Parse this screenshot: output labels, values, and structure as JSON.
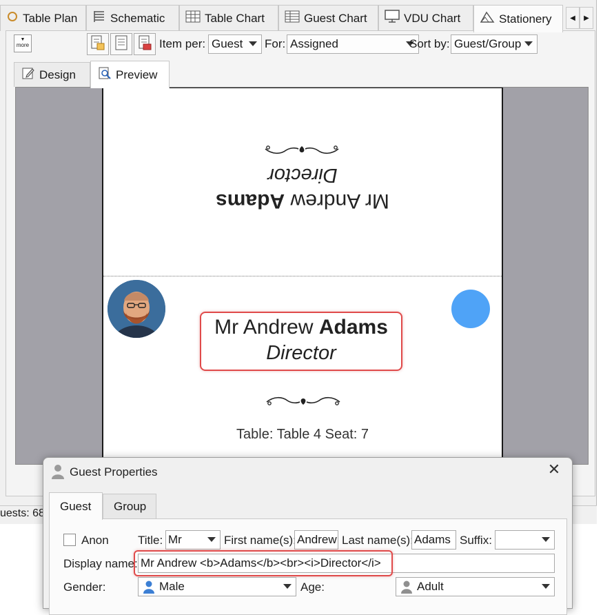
{
  "tabs": [
    {
      "label": "Table Plan",
      "icon": "table-plan-icon"
    },
    {
      "label": "Schematic",
      "icon": "schematic-icon"
    },
    {
      "label": "Table Chart",
      "icon": "table-chart-icon"
    },
    {
      "label": "Guest Chart",
      "icon": "guest-chart-icon"
    },
    {
      "label": "VDU Chart",
      "icon": "monitor-icon"
    },
    {
      "label": "Stationery",
      "icon": "stationery-icon"
    }
  ],
  "toolbar": {
    "more_label": "more",
    "item_per_label": "Item per:",
    "item_per_value": "Guest",
    "for_label": "For:",
    "for_value": "Assigned",
    "sort_by_label": "Sort by:",
    "sort_by_value": "Guest/Group"
  },
  "subtabs": [
    {
      "label": "Design",
      "icon": "design-icon"
    },
    {
      "label": "Preview",
      "icon": "preview-icon"
    }
  ],
  "card": {
    "name_prefix": "Mr Andrew",
    "name_bold": "Adams",
    "title": "Director",
    "table_seat": "Table: Table 4 Seat: 7",
    "accent_color": "#4fa3f7"
  },
  "status": {
    "guests_text": "uests: 68"
  },
  "dialog": {
    "title": "Guest Properties",
    "close_label": "✕",
    "tabs": [
      "Guest",
      "Group"
    ],
    "anon_label": "Anon",
    "title_label": "Title:",
    "title_value": "Mr",
    "first_name_label": "First name(s):",
    "first_name_value": "Andrew",
    "last_name_label": "Last name(s):",
    "last_name_value": "Adams",
    "suffix_label": "Suffix:",
    "suffix_value": "",
    "display_name_label": "Display name:",
    "display_name_value": "Mr Andrew <b>Adams</b><br><i>Director</i>",
    "gender_label": "Gender:",
    "gender_value": "Male",
    "age_label": "Age:",
    "age_value": "Adult"
  },
  "colors": {
    "highlight": "#e04a4a",
    "preview_bg": "#a2a1a8"
  }
}
